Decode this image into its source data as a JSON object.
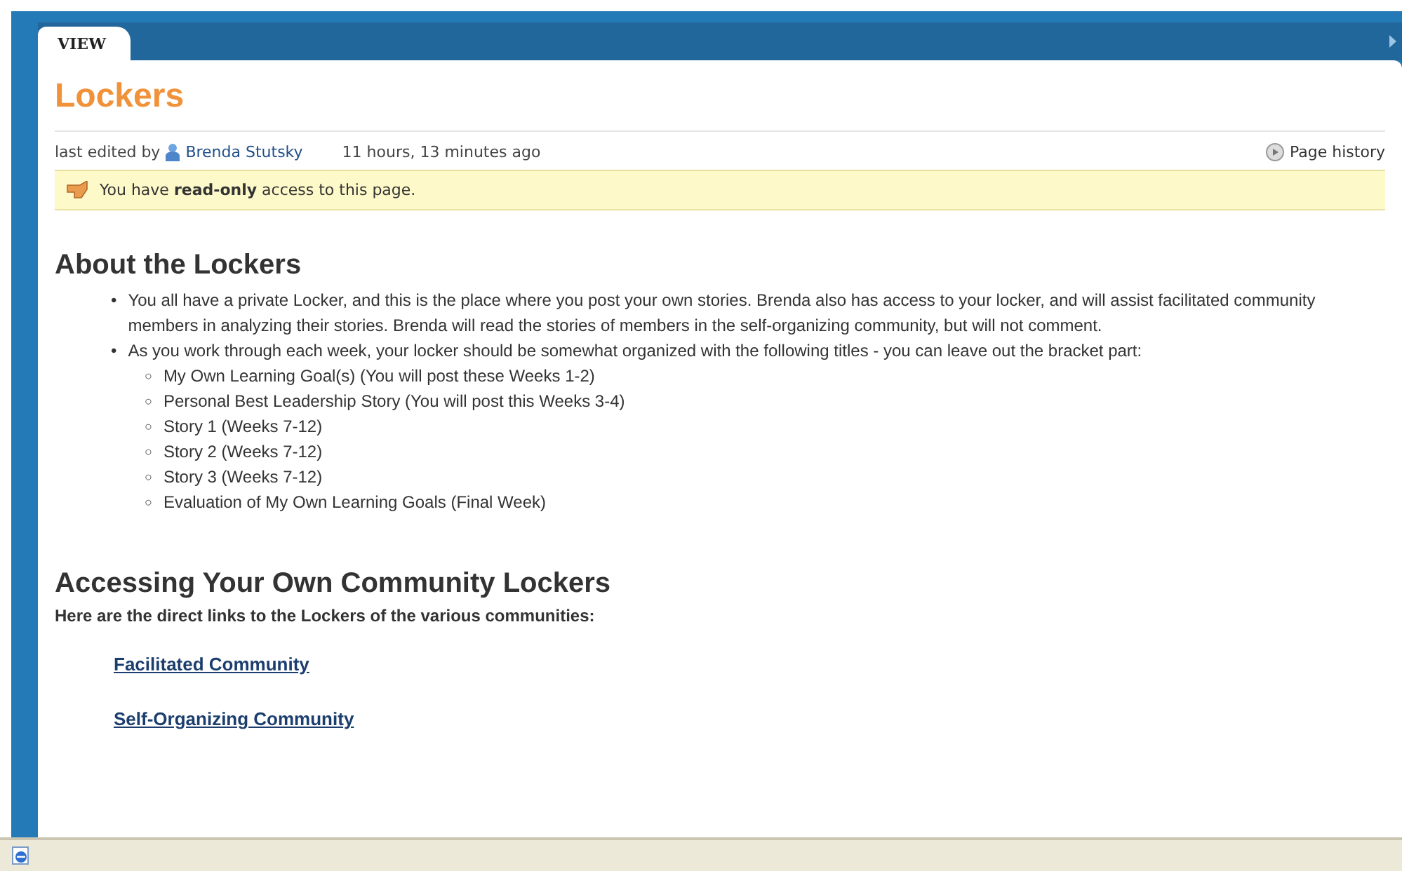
{
  "tabs": [
    {
      "label": "VIEW",
      "selected": true
    }
  ],
  "page": {
    "title": "Lockers",
    "edited_prefix": "last edited by",
    "author": "Brenda Stutsky",
    "edited_time": "11 hours, 13 minutes ago",
    "history_link": "Page history"
  },
  "notice": "You have **read-only** access to this page.",
  "sections": [
    {
      "heading": "About the Lockers",
      "bullets": [
        {
          "marker": "•",
          "text": "You all have a private Locker, and this is the place where you post your own stories. Brenda also has access to your locker, and will assist facilitated community members in analyzing their stories. Brenda will read the stories of members in the self-organizing community, but will not comment."
        },
        {
          "marker": "•",
          "text": "As you work through each week, your locker should be somewhat organized with the following titles - you can leave out the bracket part:",
          "children": [
            {
              "marker": "○",
              "text": "My Own Learning Goal(s) (You will post these Weeks 1-2)"
            },
            {
              "marker": "○",
              "text": "Personal Best Leadership Story (You will post this Weeks 3-4)"
            },
            {
              "marker": "○",
              "text": "Story 1 (Weeks 7-12)"
            },
            {
              "marker": "○",
              "text": "Story 2 (Weeks 7-12)"
            },
            {
              "marker": "○",
              "text": "Story 3 (Weeks 7-12)"
            },
            {
              "marker": "○",
              "text": "Evaluation of My Own Learning Goals (Final Week)"
            }
          ]
        }
      ]
    },
    {
      "heading": "Accessing Your Own Community Lockers",
      "intro": "Here are the direct links to the Lockers of the various communities:",
      "links": [
        "Facilitated Community",
        "Self-Organizing Community"
      ]
    }
  ]
}
